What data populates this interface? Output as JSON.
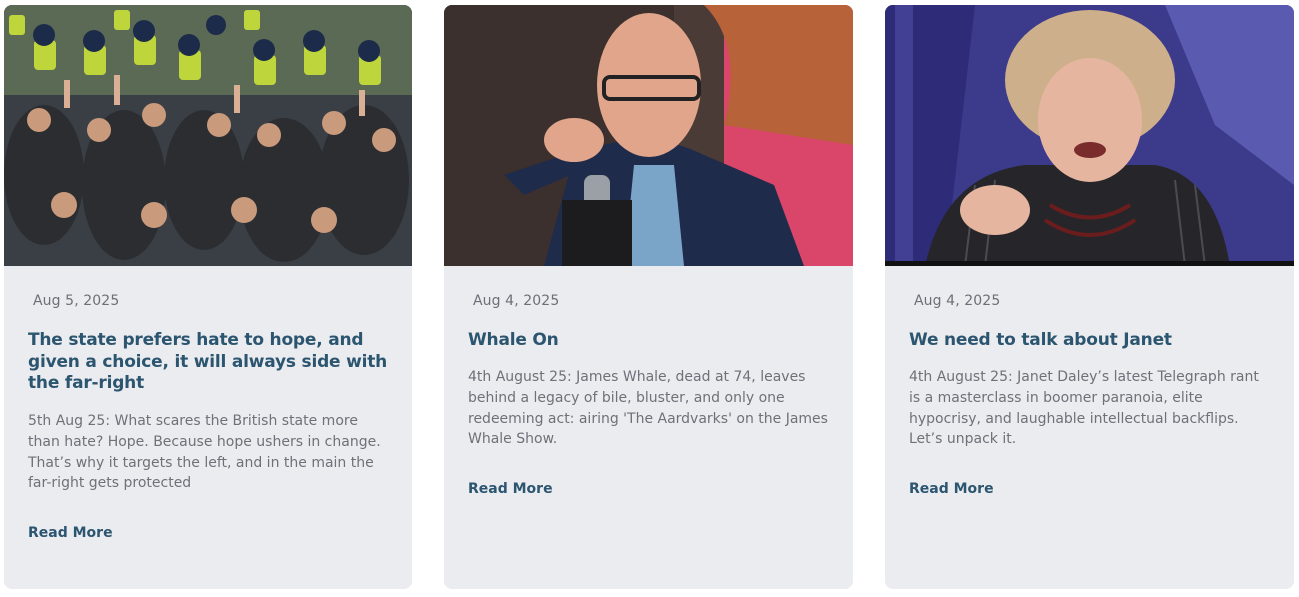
{
  "posts": [
    {
      "date": "Aug 5, 2025",
      "title": "The state prefers hate to hope, and given a choice, it will always side with the far-right",
      "excerpt": "5th Aug 25: What scares the British state more than hate? Hope. Because hope ushers in change. That’s why it targets the left, and in the main the far-right gets protected",
      "read_more": "Read More",
      "image_icon": "crowd-protest-photo"
    },
    {
      "date": "Aug 4, 2025",
      "title": "Whale On",
      "excerpt": "4th August 25: James Whale, dead at 74, leaves behind a legacy of bile, bluster, and only one redeeming act: airing 'The Aardvarks' on the James Whale Show.",
      "read_more": "Read More",
      "image_icon": "man-pointing-microphone-photo"
    },
    {
      "date": "Aug 4, 2025",
      "title": "We need to talk about Janet",
      "excerpt": "4th August 25: Janet Daley’s latest Telegraph rant is a masterclass in boomer paranoia, elite hypocrisy, and laughable intellectual backflips. Let’s unpack it.",
      "read_more": "Read More",
      "image_icon": "woman-speaking-tv-photo"
    }
  ],
  "colors": {
    "card_bg": "#ebecf0",
    "title": "#2c5570",
    "text": "#6d7178"
  }
}
